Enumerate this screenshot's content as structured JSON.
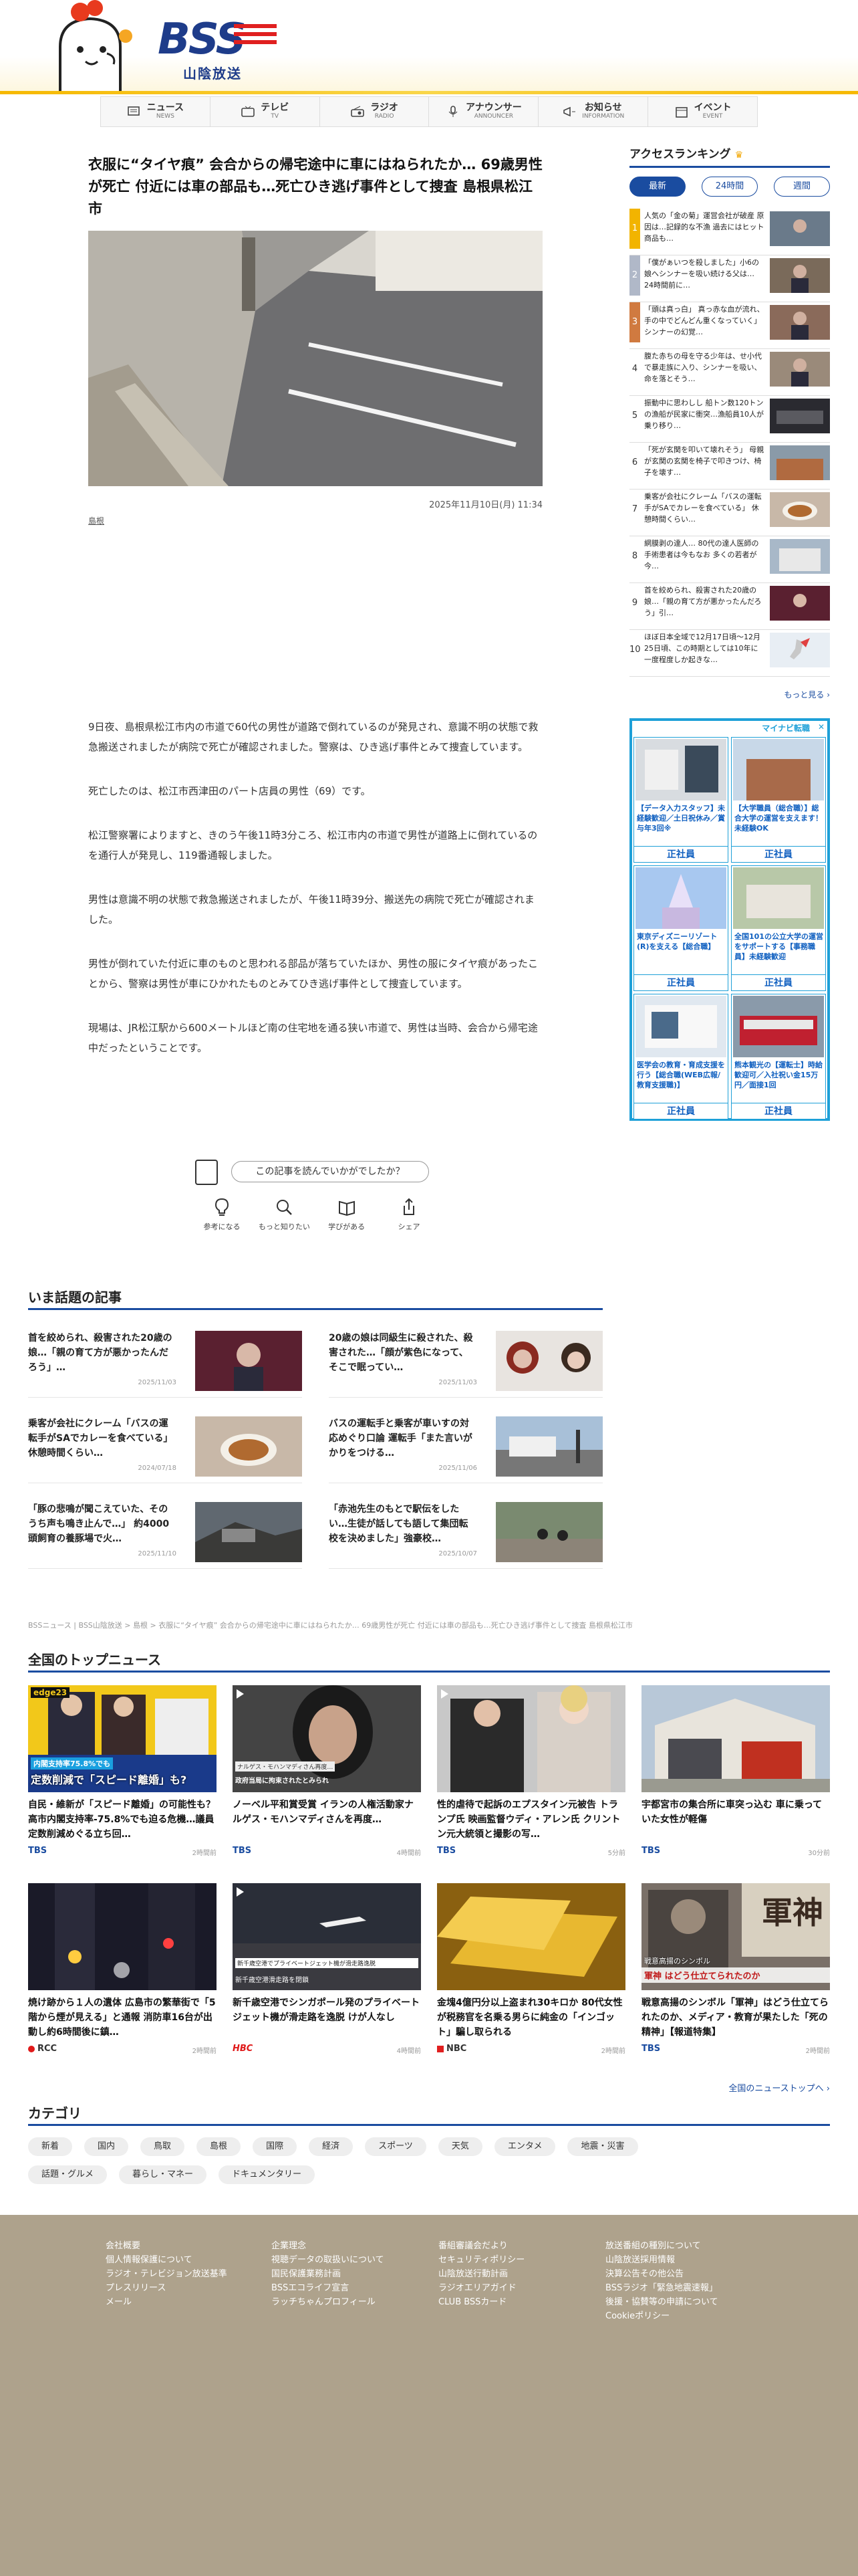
{
  "brand": {
    "logo_text": "BSS",
    "logo_sub": "山陰放送"
  },
  "nav": [
    {
      "label": "ニュース",
      "en": "NEWS",
      "icon": "news-icon"
    },
    {
      "label": "テレビ",
      "en": "TV",
      "icon": "tv-icon"
    },
    {
      "label": "ラジオ",
      "en": "RADIO",
      "icon": "radio-icon"
    },
    {
      "label": "アナウンサー",
      "en": "ANNOUNCER",
      "icon": "mic-icon"
    },
    {
      "label": "お知らせ",
      "en": "INFORMATION",
      "icon": "megaphone-icon"
    },
    {
      "label": "イベント",
      "en": "EVENT",
      "icon": "calendar-icon"
    }
  ],
  "article": {
    "title": "衣服に“タイヤ痕” 会合からの帰宅途中に車にはねられたか… 69歳男性が死亡 付近には車の部品も…死亡ひき逃げ事件として捜査 島根県松江市",
    "date": "2025年11月10日(月) 11:34",
    "tag": "島根",
    "paragraphs": [
      "9日夜、島根県松江市内の市道で60代の男性が道路で倒れているのが発見され、意識不明の状態で救急搬送されましたが病院で死亡が確認されました。警察は、ひき逃げ事件とみて捜査しています。",
      "死亡したのは、松江市西津田のパート店員の男性（69）です。",
      "松江警察署によりますと、きのう午後11時3分ころ、松江市内の市道で男性が道路上に倒れているのを通行人が発見し、119番通報しました。",
      "男性は意識不明の状態で救急搬送されましたが、午後11時39分、搬送先の病院で死亡が確認されました。",
      "男性が倒れていた付近に車のものと思われる部品が落ちていたほか、男性の服にタイヤ痕があったことから、警察は男性が車にひかれたものとみてひき逃げ事件として捜査しています。",
      "現場は、JR松江駅から600メートルほど南の住宅地を通る狭い市道で、男性は当時、会合から帰宅途中だったということです。"
    ],
    "survey_question": "この記事を読んでいかがでしたか？",
    "reactions": [
      {
        "label": "参考になる",
        "icon": "lightbulb-icon"
      },
      {
        "label": "もっと知りたい",
        "icon": "magnifier-icon"
      },
      {
        "label": "学びがある",
        "icon": "book-icon"
      },
      {
        "label": "シェア",
        "icon": "share-icon"
      }
    ]
  },
  "hot": {
    "title": "いま話題の記事",
    "items": [
      {
        "title": "首を絞められ、殺害された20歳の娘…「親の育て方が悪かったんだろう」…",
        "date": "2025/11/03"
      },
      {
        "title": "20歳の娘は同級生に殺された、殺害された…「顔が紫色になって、そこで眠ってい…",
        "date": "2025/11/03"
      },
      {
        "title": "乗客が会社にクレーム「バスの運転手がSAでカレーを食べている」 休憩時間くらい…",
        "date": "2024/07/18"
      },
      {
        "title": "バスの運転手と乗客が車いすの対応めぐり口論 運転手「また言いがかりをつける…",
        "date": "2025/11/06"
      },
      {
        "title": "「豚の悲鳴が聞こえていた、そのうち声も鳴き止んで…」 約4000頭飼育の養豚場で火…",
        "date": "2025/11/10"
      },
      {
        "title": "「赤池先生のもとで駅伝をしたい…生徒が話しても語して集団転校を決めました」強豪校…",
        "date": "2025/10/07"
      }
    ]
  },
  "breadcrumb": "BSSニュース | BSS山陰放送 > 島根 > 衣服に“タイヤ痕” 会合からの帰宅途中に車にはねられたか… 69歳男性が死亡 付近には車の部品も…死亡ひき逃げ事件として捜査 島根県松江市",
  "top_news": {
    "title": "全国のトップニュース",
    "items": [
      {
        "title": "自民・維新が「スピード離婚」の可能性も？ 高市内閣支持率-75.8%でも迫る危機…議員定数削減めぐる立ち回…",
        "source": "TBS",
        "ago": "2時間前",
        "badge": "edge23",
        "caption1": "内閣支持率75.8%でも",
        "caption2": "定数削減で「スピード離婚」も?"
      },
      {
        "title": "ノーベル平和賞受賞 イランの人権活動家ナルゲス・モハンマディさんを再度…",
        "source": "TBS",
        "ago": "4時間前",
        "badge": "",
        "caption1": "ナルゲス・モハンマディさん再度…",
        "caption2": "政府当局に拘束されたとみられ"
      },
      {
        "title": "性的虐待で起訴のエプスタイン元被告 トランプ氏 映画監督ウディ・アレン氏 クリントン元大統領と撮影の写…",
        "source": "TBS",
        "ago": "5分前",
        "badge": "",
        "caption1": "",
        "caption2": ""
      },
      {
        "title": "宇都宮市の集合所に車突っ込む 車に乗っていた女性が軽傷",
        "source": "TBS",
        "ago": "30分前",
        "badge": "",
        "caption1": "",
        "caption2": ""
      },
      {
        "title": "焼け跡から１人の遺体 広島市の繁華街で「5階から煙が見える」と通報 消防車16台が出動し約6時間後に鎮…",
        "source": "RCC",
        "ago": "2時間前",
        "badge": "",
        "caption1": "",
        "caption2": ""
      },
      {
        "title": "新千歳空港でシンガポール発のプライベートジェット機が滑走路を逸脱 けが人なし",
        "source": "HBC",
        "ago": "4時間前",
        "badge": "",
        "caption1": "新千歳空港でプライベートジェット機が滑走路逸脱",
        "caption2": "新千歳空港滑走路を閉鎖"
      },
      {
        "title": "金塊4億円分以上盗まれ30キロか 80代女性が税務官を名乗る男らに純金の「インゴット」騙し取られる",
        "source": "NBC",
        "ago": "2時間前",
        "badge": "",
        "caption1": "",
        "caption2": ""
      },
      {
        "title": "戦意高揚のシンボル「軍神」はどう仕立てられたのか、メディア・教育が果たした「死の精神」【報道特集】",
        "source": "TBS",
        "ago": "2時間前",
        "badge": "",
        "caption1": "戦意高揚のシンボル",
        "caption2": "軍神 はどう仕立てられたのか"
      }
    ],
    "more": "全国のニューストップへ ›"
  },
  "categories": {
    "title": "カテゴリ",
    "items": [
      "新着",
      "国内",
      "鳥取",
      "島根",
      "国際",
      "経済",
      "スポーツ",
      "天気",
      "エンタメ",
      "地震・災害",
      "話題・グルメ",
      "暮らし・マネー",
      "ドキュメンタリー"
    ]
  },
  "footer": {
    "col1": [
      "会社概要",
      "個人情報保護について",
      "ラジオ・テレビジョン放送基準",
      "プレスリリース",
      "メール"
    ],
    "col2": [
      "企業理念",
      "視聴データの取扱いについて",
      "国民保護業務計画",
      "BSSエコライフ宣言",
      "ラッチちゃんプロフィール"
    ],
    "col3": [
      "番組審議会だより",
      "セキュリティポリシー",
      "山陰放送行動計画",
      "ラジオエリアガイド",
      "CLUB BSSカード"
    ],
    "col4": [
      "放送番組の種別について",
      "山陰放送採用情報",
      "決算公告その他公告",
      "BSSラジオ「緊急地震速報」",
      "後援・協賛等の申請について",
      "Cookieポリシー"
    ]
  },
  "ranking": {
    "title": "アクセスランキング",
    "tabs": [
      "最新",
      "24時間",
      "週間"
    ],
    "items": [
      {
        "n": "1",
        "title": "人気の「金の菊」運営会社が破産 原因は…記録的な不漁 過去にはヒット商品も…"
      },
      {
        "n": "2",
        "title": "「僕がぁいつを殺しました」小6の娘へシンナーを吸い続ける父は… 24時間前に…"
      },
      {
        "n": "3",
        "title": "「頭は真っ白」 真っ赤な血が流れ、手の中でどんどん重くなっていく」 シンナーの幻覚…"
      },
      {
        "n": "4",
        "title": "腹た赤ちの母を守る少年は、せ小代で暴走族に入り、シンナーを吸い、命を落とそう…"
      },
      {
        "n": "5",
        "title": "振動中に思わしし 船トン数120トンの漁船が民家に衝突…漁船員10人が乗り移り…"
      },
      {
        "n": "6",
        "title": "「死が玄関を叩いて壊れそう」 母親が玄関の玄関を椅子で叩きつけ、椅子を壊す…"
      },
      {
        "n": "7",
        "title": "乗客が会社にクレーム「バスの運転手がSAでカレーを食べている」 休憩時間くらい…"
      },
      {
        "n": "8",
        "title": "網膜剥の達人… 80代の達人医師の手術患者は今もなお 多くの若者が今…"
      },
      {
        "n": "9",
        "title": "首を絞められ、殺害された20歳の娘…「親の育て方が悪かったんだろう」引…"
      },
      {
        "n": "10",
        "title": "ほぼ日本全域で12月17日頃〜12月25日頃、この時期としては10年に一度程度しか起きな…"
      }
    ],
    "more": "もっと見る ›"
  },
  "ad": {
    "brand": "マイナビ転職",
    "cells": [
      {
        "title": "【データ入力スタッフ】未経験歓迎／土日祝休み／賞与年3回※",
        "btn": "正社員"
      },
      {
        "title": "【大学職員（総合職）】総合大学の運営を支えます！未経験OK",
        "btn": "正社員"
      },
      {
        "title": "東京ディズニーリゾート(R)を支える【総合職】",
        "btn": "正社員"
      },
      {
        "title": "全国101の公立大学の運営をサポートする【事務職員】未経験歓迎",
        "btn": "正社員"
      },
      {
        "title": "医学会の教育・育成支援を行う【総合職(WEB広報/教育支援職)】",
        "btn": "正社員"
      },
      {
        "title": "熊本観光の【運転士】時給歓迎可／入社祝い金15万円／面接1回",
        "btn": "正社員"
      }
    ]
  }
}
